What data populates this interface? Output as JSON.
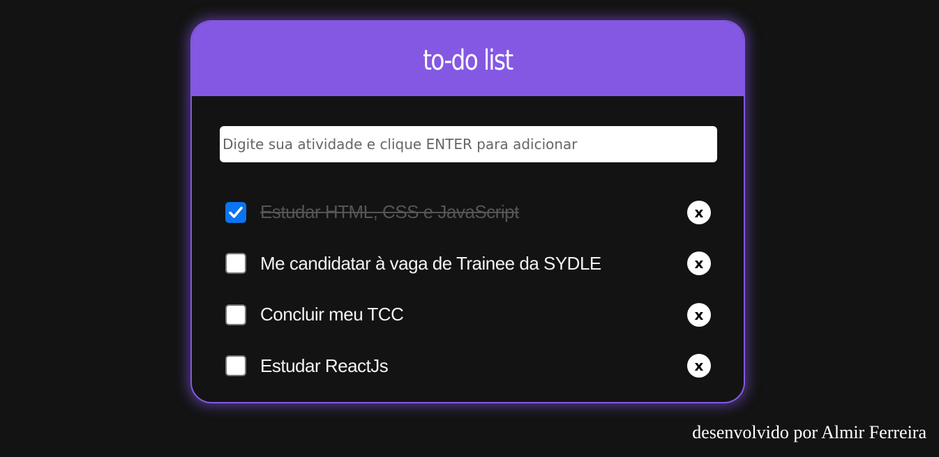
{
  "header": {
    "title": "to-do list"
  },
  "input": {
    "placeholder": "Digite sua atividade e clique ENTER para adicionar",
    "value": ""
  },
  "tasks": [
    {
      "text": "Estudar HTML, CSS e JavaScript",
      "done": true,
      "delete_label": "x"
    },
    {
      "text": "Me candidatar à vaga de Trainee da SYDLE",
      "done": false,
      "delete_label": "x"
    },
    {
      "text": "Concluir meu TCC",
      "done": false,
      "delete_label": "x"
    },
    {
      "text": "Estudar ReactJs",
      "done": false,
      "delete_label": "x"
    }
  ],
  "footer": {
    "credit": "desenvolvido por Almir Ferreira"
  },
  "colors": {
    "accent": "#8458e3",
    "background": "#131313",
    "checkbox_checked": "#0b74f0",
    "done_text": "#555555"
  },
  "icons": {
    "check": "checkmark-icon"
  }
}
